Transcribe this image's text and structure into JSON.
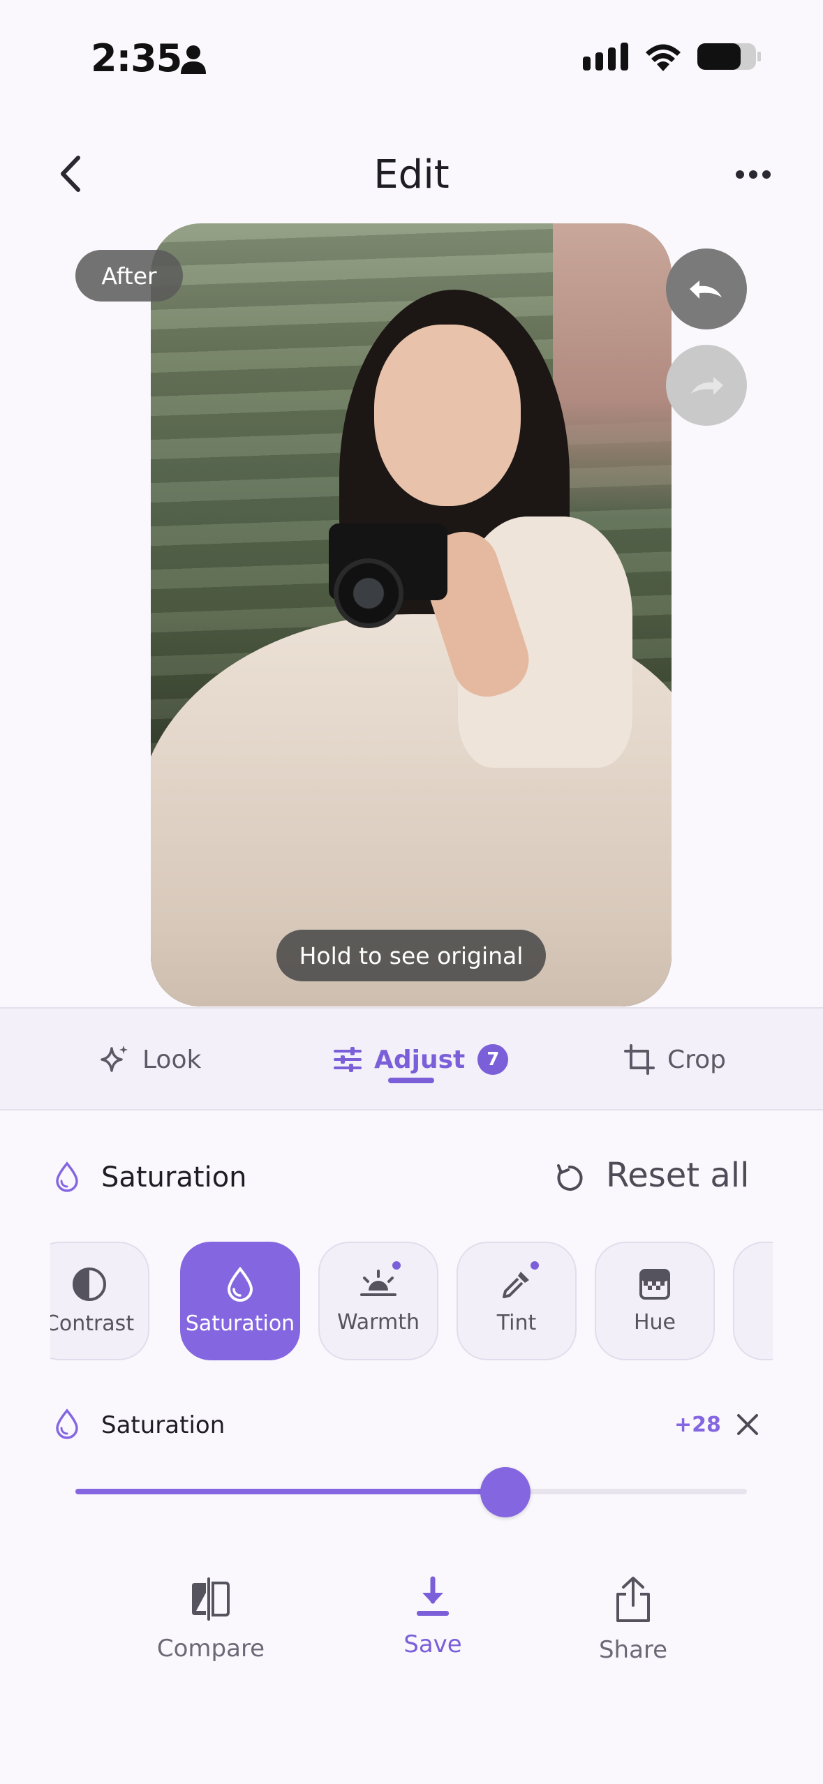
{
  "status_bar": {
    "time": "2:35"
  },
  "header": {
    "title": "Edit"
  },
  "photo": {
    "state_label": "After",
    "hold_hint": "Hold to see original"
  },
  "tabs": [
    {
      "label": "Look",
      "icon": "sparkle-icon"
    },
    {
      "label": "Adjust",
      "icon": "sliders-icon",
      "badge": "7",
      "active": true
    },
    {
      "label": "Crop",
      "icon": "crop-icon"
    }
  ],
  "section": {
    "title": "Saturation",
    "reset_label": "Reset all"
  },
  "chips": [
    {
      "label": "Contrast",
      "icon": "contrast-icon",
      "active": false,
      "modified": false
    },
    {
      "label": "Saturation",
      "icon": "droplet-icon",
      "active": true,
      "modified": false
    },
    {
      "label": "Warmth",
      "icon": "sunset-icon",
      "active": false,
      "modified": true
    },
    {
      "label": "Tint",
      "icon": "eyedropper-icon",
      "active": false,
      "modified": true
    },
    {
      "label": "Hue",
      "icon": "checker-icon",
      "active": false,
      "modified": false
    }
  ],
  "slider": {
    "label": "Saturation",
    "value_text": "+28",
    "value": 28,
    "fill_fraction": 0.64
  },
  "actions": {
    "compare": "Compare",
    "save": "Save",
    "share": "Share"
  },
  "colors": {
    "accent": "#8466e0",
    "background": "#faf8fd",
    "tab_bar": "#f3f0f9"
  }
}
